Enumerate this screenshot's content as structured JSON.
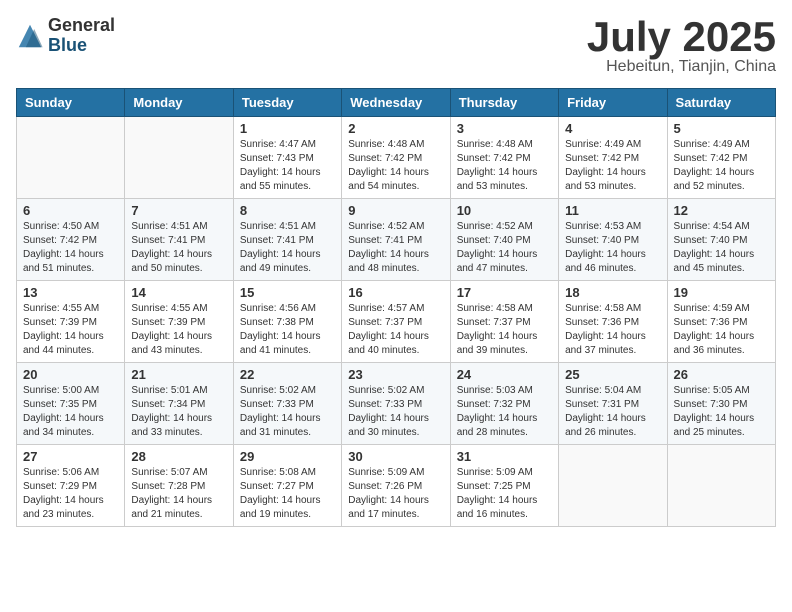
{
  "header": {
    "logo_general": "General",
    "logo_blue": "Blue",
    "month": "July 2025",
    "location": "Hebeitun, Tianjin, China"
  },
  "weekdays": [
    "Sunday",
    "Monday",
    "Tuesday",
    "Wednesday",
    "Thursday",
    "Friday",
    "Saturday"
  ],
  "weeks": [
    [
      {
        "day": "",
        "sunrise": "",
        "sunset": "",
        "daylight": ""
      },
      {
        "day": "",
        "sunrise": "",
        "sunset": "",
        "daylight": ""
      },
      {
        "day": "1",
        "sunrise": "Sunrise: 4:47 AM",
        "sunset": "Sunset: 7:43 PM",
        "daylight": "Daylight: 14 hours and 55 minutes."
      },
      {
        "day": "2",
        "sunrise": "Sunrise: 4:48 AM",
        "sunset": "Sunset: 7:42 PM",
        "daylight": "Daylight: 14 hours and 54 minutes."
      },
      {
        "day": "3",
        "sunrise": "Sunrise: 4:48 AM",
        "sunset": "Sunset: 7:42 PM",
        "daylight": "Daylight: 14 hours and 53 minutes."
      },
      {
        "day": "4",
        "sunrise": "Sunrise: 4:49 AM",
        "sunset": "Sunset: 7:42 PM",
        "daylight": "Daylight: 14 hours and 53 minutes."
      },
      {
        "day": "5",
        "sunrise": "Sunrise: 4:49 AM",
        "sunset": "Sunset: 7:42 PM",
        "daylight": "Daylight: 14 hours and 52 minutes."
      }
    ],
    [
      {
        "day": "6",
        "sunrise": "Sunrise: 4:50 AM",
        "sunset": "Sunset: 7:42 PM",
        "daylight": "Daylight: 14 hours and 51 minutes."
      },
      {
        "day": "7",
        "sunrise": "Sunrise: 4:51 AM",
        "sunset": "Sunset: 7:41 PM",
        "daylight": "Daylight: 14 hours and 50 minutes."
      },
      {
        "day": "8",
        "sunrise": "Sunrise: 4:51 AM",
        "sunset": "Sunset: 7:41 PM",
        "daylight": "Daylight: 14 hours and 49 minutes."
      },
      {
        "day": "9",
        "sunrise": "Sunrise: 4:52 AM",
        "sunset": "Sunset: 7:41 PM",
        "daylight": "Daylight: 14 hours and 48 minutes."
      },
      {
        "day": "10",
        "sunrise": "Sunrise: 4:52 AM",
        "sunset": "Sunset: 7:40 PM",
        "daylight": "Daylight: 14 hours and 47 minutes."
      },
      {
        "day": "11",
        "sunrise": "Sunrise: 4:53 AM",
        "sunset": "Sunset: 7:40 PM",
        "daylight": "Daylight: 14 hours and 46 minutes."
      },
      {
        "day": "12",
        "sunrise": "Sunrise: 4:54 AM",
        "sunset": "Sunset: 7:40 PM",
        "daylight": "Daylight: 14 hours and 45 minutes."
      }
    ],
    [
      {
        "day": "13",
        "sunrise": "Sunrise: 4:55 AM",
        "sunset": "Sunset: 7:39 PM",
        "daylight": "Daylight: 14 hours and 44 minutes."
      },
      {
        "day": "14",
        "sunrise": "Sunrise: 4:55 AM",
        "sunset": "Sunset: 7:39 PM",
        "daylight": "Daylight: 14 hours and 43 minutes."
      },
      {
        "day": "15",
        "sunrise": "Sunrise: 4:56 AM",
        "sunset": "Sunset: 7:38 PM",
        "daylight": "Daylight: 14 hours and 41 minutes."
      },
      {
        "day": "16",
        "sunrise": "Sunrise: 4:57 AM",
        "sunset": "Sunset: 7:37 PM",
        "daylight": "Daylight: 14 hours and 40 minutes."
      },
      {
        "day": "17",
        "sunrise": "Sunrise: 4:58 AM",
        "sunset": "Sunset: 7:37 PM",
        "daylight": "Daylight: 14 hours and 39 minutes."
      },
      {
        "day": "18",
        "sunrise": "Sunrise: 4:58 AM",
        "sunset": "Sunset: 7:36 PM",
        "daylight": "Daylight: 14 hours and 37 minutes."
      },
      {
        "day": "19",
        "sunrise": "Sunrise: 4:59 AM",
        "sunset": "Sunset: 7:36 PM",
        "daylight": "Daylight: 14 hours and 36 minutes."
      }
    ],
    [
      {
        "day": "20",
        "sunrise": "Sunrise: 5:00 AM",
        "sunset": "Sunset: 7:35 PM",
        "daylight": "Daylight: 14 hours and 34 minutes."
      },
      {
        "day": "21",
        "sunrise": "Sunrise: 5:01 AM",
        "sunset": "Sunset: 7:34 PM",
        "daylight": "Daylight: 14 hours and 33 minutes."
      },
      {
        "day": "22",
        "sunrise": "Sunrise: 5:02 AM",
        "sunset": "Sunset: 7:33 PM",
        "daylight": "Daylight: 14 hours and 31 minutes."
      },
      {
        "day": "23",
        "sunrise": "Sunrise: 5:02 AM",
        "sunset": "Sunset: 7:33 PM",
        "daylight": "Daylight: 14 hours and 30 minutes."
      },
      {
        "day": "24",
        "sunrise": "Sunrise: 5:03 AM",
        "sunset": "Sunset: 7:32 PM",
        "daylight": "Daylight: 14 hours and 28 minutes."
      },
      {
        "day": "25",
        "sunrise": "Sunrise: 5:04 AM",
        "sunset": "Sunset: 7:31 PM",
        "daylight": "Daylight: 14 hours and 26 minutes."
      },
      {
        "day": "26",
        "sunrise": "Sunrise: 5:05 AM",
        "sunset": "Sunset: 7:30 PM",
        "daylight": "Daylight: 14 hours and 25 minutes."
      }
    ],
    [
      {
        "day": "27",
        "sunrise": "Sunrise: 5:06 AM",
        "sunset": "Sunset: 7:29 PM",
        "daylight": "Daylight: 14 hours and 23 minutes."
      },
      {
        "day": "28",
        "sunrise": "Sunrise: 5:07 AM",
        "sunset": "Sunset: 7:28 PM",
        "daylight": "Daylight: 14 hours and 21 minutes."
      },
      {
        "day": "29",
        "sunrise": "Sunrise: 5:08 AM",
        "sunset": "Sunset: 7:27 PM",
        "daylight": "Daylight: 14 hours and 19 minutes."
      },
      {
        "day": "30",
        "sunrise": "Sunrise: 5:09 AM",
        "sunset": "Sunset: 7:26 PM",
        "daylight": "Daylight: 14 hours and 17 minutes."
      },
      {
        "day": "31",
        "sunrise": "Sunrise: 5:09 AM",
        "sunset": "Sunset: 7:25 PM",
        "daylight": "Daylight: 14 hours and 16 minutes."
      },
      {
        "day": "",
        "sunrise": "",
        "sunset": "",
        "daylight": ""
      },
      {
        "day": "",
        "sunrise": "",
        "sunset": "",
        "daylight": ""
      }
    ]
  ]
}
